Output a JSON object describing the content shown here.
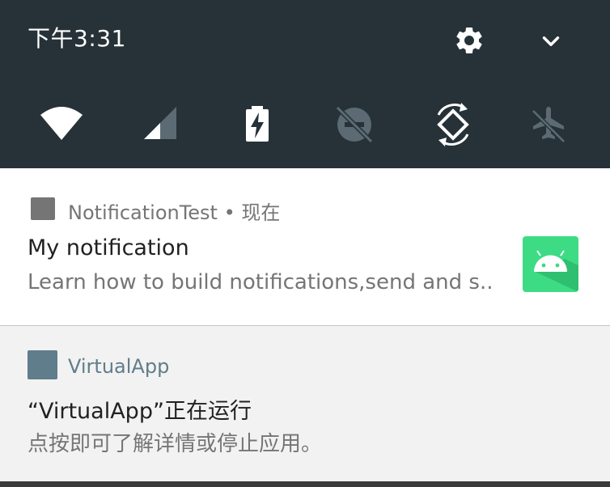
{
  "status_bar": {
    "time": "下午3:31"
  },
  "quick_settings": {
    "tiles": [
      {
        "icon": "wifi-icon"
      },
      {
        "icon": "cellular-signal-icon"
      },
      {
        "icon": "battery-charging-icon"
      },
      {
        "icon": "do-not-disturb-off-icon"
      },
      {
        "icon": "auto-rotate-icon"
      },
      {
        "icon": "airplane-mode-off-icon"
      }
    ]
  },
  "notifications": [
    {
      "app_name": "NotificationTest",
      "separator": "•",
      "when": "现在",
      "title": "My notification",
      "text": "Learn how to build notifications,send and s..",
      "large_icon": "android-robot-icon"
    },
    {
      "app_name": "VirtualApp",
      "title": "“VirtualApp”正在运行",
      "text": "点按即可了解详情或停止应用。"
    }
  ],
  "colors": {
    "shade_bg": "#263238",
    "card_bg": "#ffffff",
    "card2_bg": "#f2f2f2",
    "app1_icon": "#757575",
    "app2_icon": "#607d8b",
    "app2_name": "#607d8b",
    "android_green": "#3ddc84"
  }
}
